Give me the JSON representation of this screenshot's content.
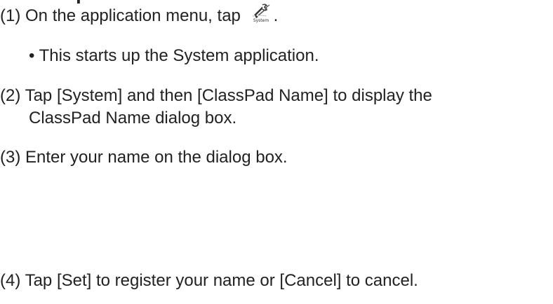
{
  "header": {
    "partial_title": "p"
  },
  "steps": [
    {
      "num": "(1)",
      "text": "On the application menu, tap",
      "icon": "system-app-icon",
      "icon_caption": "System",
      "after_icon": "."
    },
    {
      "bullet": "• This starts up the System application."
    },
    {
      "num": "(2)",
      "text": "Tap [System] and then [ClassPad Name] to display the",
      "continuation": "ClassPad Name dialog box."
    },
    {
      "num": "(3)",
      "text": "Enter your name on the dialog box."
    },
    {
      "num": "(4)",
      "text": "Tap [Set] to register your name or [Cancel] to cancel."
    }
  ]
}
